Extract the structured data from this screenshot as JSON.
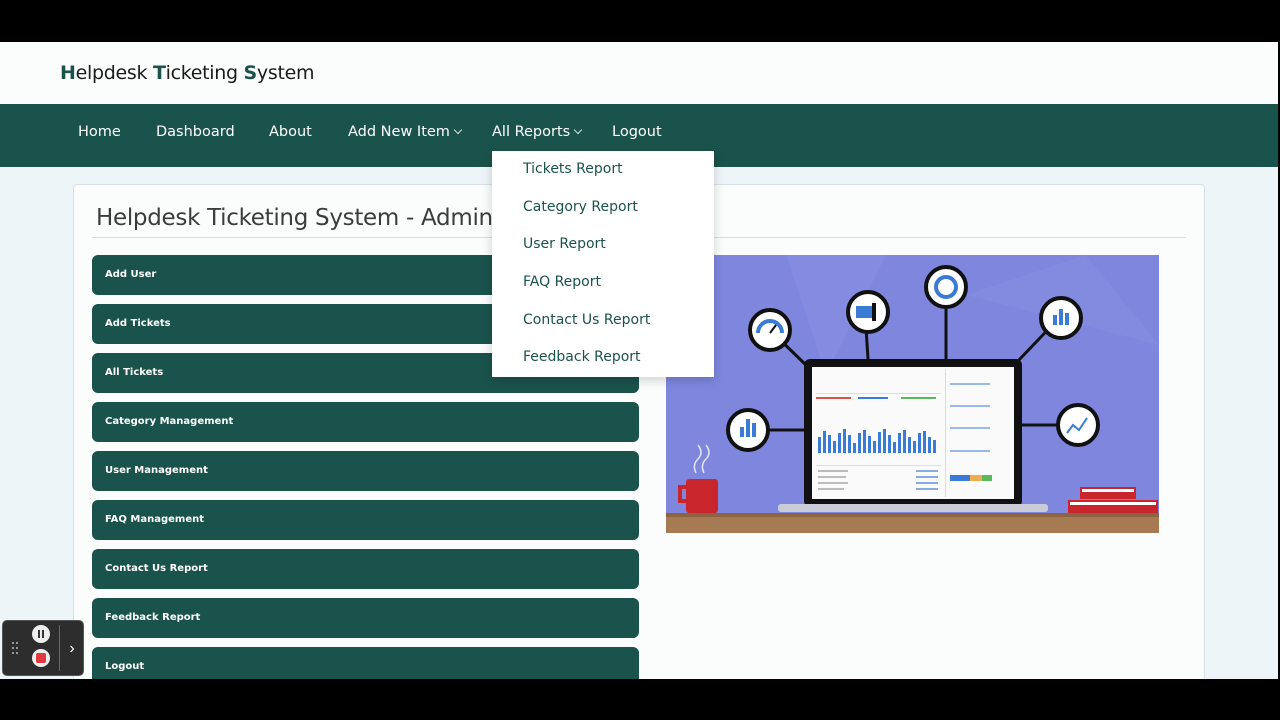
{
  "brand": {
    "H": "H",
    "elpdesk": "elpdesk ",
    "T": "T",
    "icketing": "icketing ",
    "S": "S",
    "ystem": "ystem"
  },
  "nav": {
    "home": "Home",
    "dashboard": "Dashboard",
    "about": "About",
    "add_new_item": "Add New Item",
    "all_reports": "All Reports",
    "logout": "Logout"
  },
  "dropdown": {
    "items": [
      "Tickets Report",
      "Category Report",
      "User Report",
      "FAQ Report",
      "Contact Us Report",
      "Feedback Report"
    ]
  },
  "main": {
    "title": "Helpdesk Ticketing System - Admin Dashboard",
    "buttons": [
      "Add User",
      "Add Tickets",
      "All Tickets",
      "Category Management",
      "User Management",
      "FAQ Management",
      "Contact Us Report",
      "Feedback Report",
      "Logout"
    ]
  },
  "colors": {
    "primary": "#1a534b",
    "hero_bg": "#7e86de",
    "accent_blue": "#3a7bd5"
  },
  "recorder": {
    "arrow": "›"
  }
}
